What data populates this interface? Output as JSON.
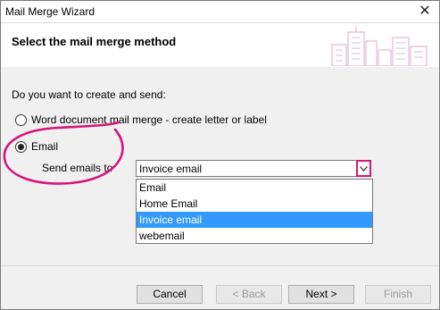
{
  "window": {
    "title": "Mail Merge Wizard",
    "close_glyph": "✕"
  },
  "header": {
    "title": "Select the mail merge method",
    "illustration_icon": "city-skyline-icon"
  },
  "content": {
    "question": "Do you want to create and send:",
    "options": [
      {
        "label": "Word document mail merge - create letter or label",
        "checked": false
      },
      {
        "label": "Email",
        "checked": true
      }
    ],
    "send_to_label": "Send emails to",
    "combo_value": "Invoice email",
    "dropdown_items": [
      "Email",
      "Home Email",
      "Invoice email",
      "webemail"
    ],
    "selected_index": 2
  },
  "footer": {
    "cancel": "Cancel",
    "back": "< Back",
    "next": "Next >",
    "finish": "Finish"
  },
  "colors": {
    "highlight": "#d7157c",
    "selection": "#3399ff"
  }
}
